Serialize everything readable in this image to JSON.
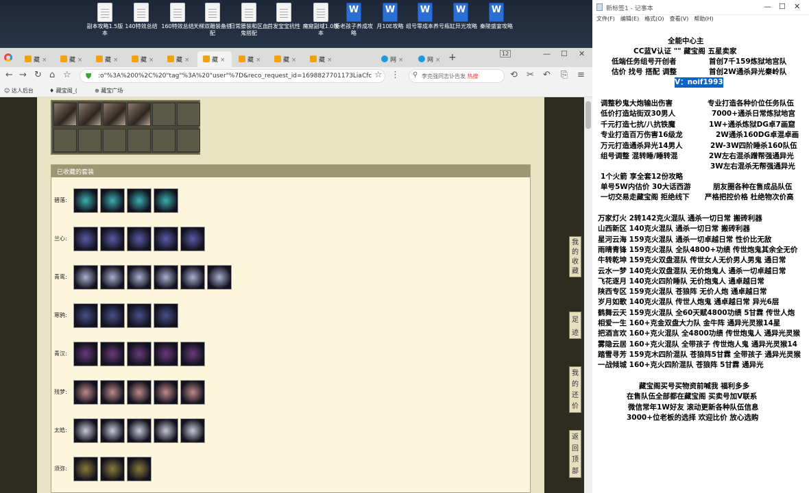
{
  "desktop_icons": [
    {
      "label": "副本攻略1.5版本",
      "type": "doc"
    },
    {
      "label": "140特效总结",
      "type": "doc"
    },
    {
      "label": "160特效总结",
      "type": "doc"
    },
    {
      "label": "天梯双雕装备搭配",
      "type": "doc"
    },
    {
      "label": "日常腰装和区血鬼搭配",
      "type": "doc"
    },
    {
      "label": "首发宝宝抗性",
      "type": "doc"
    },
    {
      "label": "魔窟副域1.0版本",
      "type": "doc"
    },
    {
      "label": "新老孩子养成攻略",
      "type": "word"
    },
    {
      "label": "月10E攻略",
      "type": "word"
    },
    {
      "label": "组号零成本养号",
      "type": "word"
    },
    {
      "label": "瓶缸异光攻略",
      "type": "word"
    },
    {
      "label": "秦陵盛宴攻略",
      "type": "word"
    }
  ],
  "browser": {
    "tabs": [
      "藏",
      "藏",
      "藏",
      "藏",
      "藏",
      "藏",
      "藏",
      "藏",
      "藏",
      "网",
      "网"
    ],
    "tab_count": "12",
    "url": ":o\"%3A%200%2C%20\"tag\"%3A%20\"user\"%7D&reco_request_id=1698827701173LiaCfc",
    "search_text": "李克强同志讣告发",
    "search_badge": "热搜",
    "bookmarks": [
      "达人后台",
      "藏宝阁_(",
      "藏宝广场"
    ]
  },
  "page": {
    "collected_sets_title": "已收藏的套装",
    "sets": [
      {
        "name": "碧落:",
        "count": 4
      },
      {
        "name": "兰心:",
        "count": 5
      },
      {
        "name": "青鸾:",
        "count": 6
      },
      {
        "name": "寒鸦:",
        "count": 4
      },
      {
        "name": "青汉:",
        "count": 5
      },
      {
        "name": "残梦:",
        "count": 5
      },
      {
        "name": "太皓:",
        "count": 5
      },
      {
        "name": "须弥:",
        "count": 3
      }
    ],
    "side_buttons": [
      "我的收藏",
      "足迹",
      "我的还价",
      "返回顶部"
    ]
  },
  "notepad": {
    "title": "新标签1 - 记事本",
    "menu": [
      "文件(F)",
      "编辑(E)",
      "格式(O)",
      "查看(V)",
      "帮助(H)"
    ],
    "header_lines": [
      "全能中心主",
      "CC蓝V认证 \"\" 藏宝阁 五星卖家",
      "低端任务组号开创者",
      "首创7千159炼狱地宫队",
      "估价 找号 搭配 调整",
      "首创2W通杀异光秦岭队"
    ],
    "contact": "V：noif1993",
    "left_col": [
      "调整秒鬼大炮输出伤害",
      "低价打造站街双30男人",
      "千元打造七抗/八抗铁魔",
      "专业打造百万伤害16级龙",
      "万元打造通杀异光14男人",
      "组号调整 混转睡/睡转混"
    ],
    "right_col": [
      "专业打造各种价位任务队伍",
      "7000+通杀日常炼狱地宫",
      "1W+通杀炼狱DG卓7画窟",
      "2W通杀160DG卓混卓画",
      "2W-3W四阶睡杀160队伍",
      "2W左右混杀蹭帮强通异光",
      "3W左右混杀无帮强通异光"
    ],
    "mid_lines": [
      "1个火箭 享全套12份攻略",
      "单号5W内估价 30大话西游",
      "朋友圈各种在售成品队伍",
      "一切交易走藏宝阁 拒绝线下",
      "严格把控价格 杜绝物次价高"
    ],
    "listings": [
      "万家灯火 2转142克火混队 通杀一切日常 搬砖利器",
      "山西新区 140克火混队 通杀一切日常 搬砖利器",
      "星河云海 159克火混队 通杀一切卓越日常 性价比无敌",
      "雨晴青锋 159克火混队 全队4800+功绩 传世炮鬼其余全无价",
      "牛转乾坤 159克火双盘混队 传世女人无价男人男鬼 通日常",
      "云水一梦 140克火双盘混队 无价炮鬼人 通杀一切卓越日常",
      "飞花逐月 140克火四阶睡队 无价炮鬼人 通卓越日常",
      "陕西专区 159克火混队 苍狼阵 无价人炮 通卓越日常",
      "岁月如歌 140克火混队 传世人炮鬼 通卓越日常 异光6层",
      "鹤舞云天 159克火混队 全60天赋4800功绩 5甘霖 传世人炮",
      "相爱一生 160+克金双盘大力队 金牛阵 通异光灵猴14星",
      "把酒言欢 160+克火混队 全4800功绩 传世炮鬼人 通异光灵猴",
      "雾隐云居 160+克火混队 全带孩子 传世炮人鬼 通异光灵猴14",
      "踏雪寻芳 159克木四阶混队 苍狼阵5甘霖 全带孩子 通异光灵猴",
      "一战倾城 160+克火四阶混队 苍狼阵 5甘霖 通异光"
    ],
    "footer_lines": [
      "藏宝阁买号买物资前喊我 福利多多",
      "在售队伍全部都在藏宝阁 买卖号加V联系",
      "微信常年1W好友 滚动更新各种队伍信息",
      "3000+位老板的选择 欢迎比价 放心选购"
    ]
  }
}
